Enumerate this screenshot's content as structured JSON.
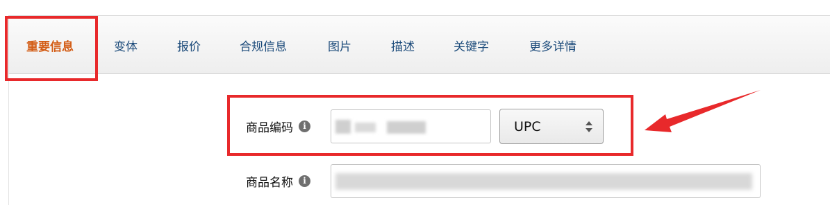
{
  "tabs": [
    {
      "label": "重要信息",
      "active": true
    },
    {
      "label": "变体"
    },
    {
      "label": "报价"
    },
    {
      "label": "合规信息"
    },
    {
      "label": "图片"
    },
    {
      "label": "描述"
    },
    {
      "label": "关键字"
    },
    {
      "label": "更多详情"
    }
  ],
  "form": {
    "product_code_label": "商品编码",
    "product_code_type": "UPC",
    "product_name_label": "商品名称"
  },
  "colors": {
    "active_tab": "#d35d16",
    "tab_text": "#1b4a7a",
    "annotation_red": "#e8292b"
  },
  "icons": [
    "info-icon",
    "select-arrows-icon",
    "arrow-annotation"
  ]
}
